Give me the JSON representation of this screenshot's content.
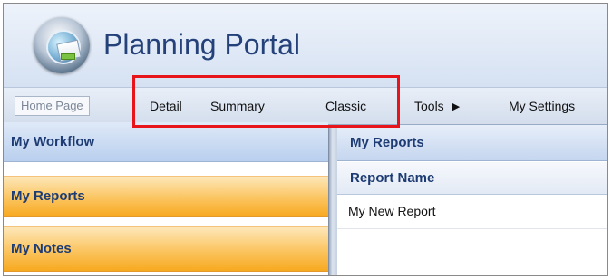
{
  "header": {
    "title": "Planning Portal",
    "logo_icon": "globe-document-icon"
  },
  "nav": {
    "home": "Home Page",
    "items": [
      "Detail",
      "Summary",
      "Classic",
      "Tools",
      "My Settings"
    ],
    "tools_arrow_icon": "caret-right-icon",
    "tools_arrow_glyph": "▶",
    "highlight_color": "#e8141c"
  },
  "sidebar": {
    "items": [
      {
        "label": "My Workflow",
        "style": "blue"
      },
      {
        "label": "My Reports",
        "style": "orange"
      },
      {
        "label": "My Notes",
        "style": "orange"
      }
    ]
  },
  "main": {
    "panel_title": "My Reports",
    "columns": [
      "Report Name"
    ],
    "rows": [
      {
        "name": "My New Report"
      }
    ]
  },
  "colors": {
    "title_text": "#24417a",
    "panel_text": "#1e3c74",
    "orange_accent": "#f7a91f"
  }
}
